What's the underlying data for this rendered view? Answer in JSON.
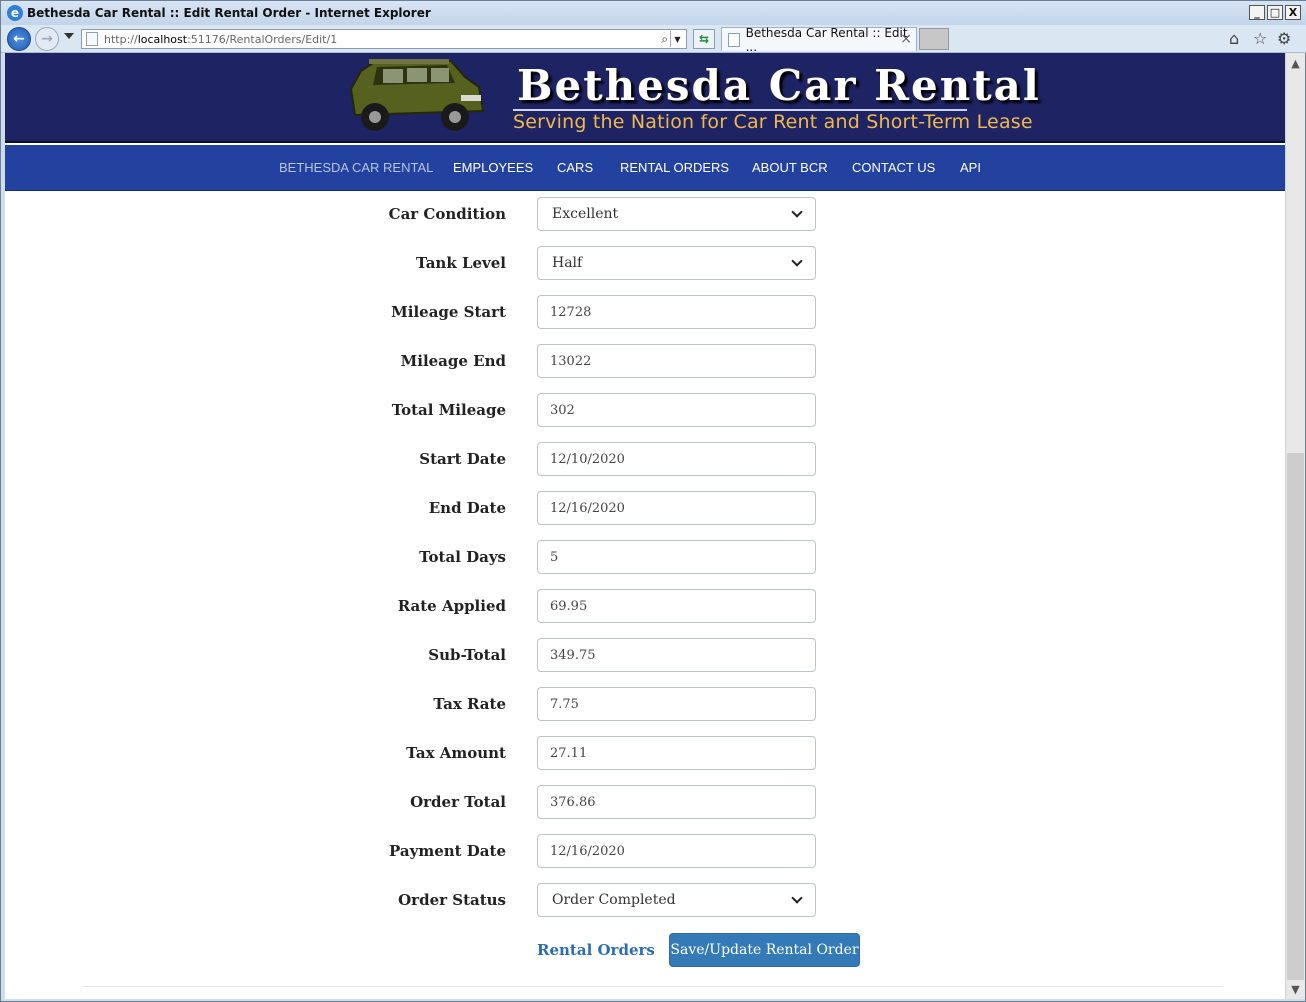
{
  "window": {
    "title": "Bethesda Car Rental :: Edit Rental Order - Internet Explorer",
    "minimize": "_",
    "maximize": "□",
    "close": "X"
  },
  "browser": {
    "url_scheme": "http://",
    "url_host": "localhost",
    "url_rest": ":51176/RentalOrders/Edit/1",
    "tab_title": "Bethesda Car Rental :: Edit ...",
    "tab_close": "×"
  },
  "site": {
    "title": "Bethesda Car Rental",
    "tagline": "Serving the Nation for Car Rent and Short-Term Lease"
  },
  "nav": {
    "brand": "BETHESDA CAR RENTAL",
    "items": [
      "EMPLOYEES",
      "CARS",
      "RENTAL ORDERS",
      "ABOUT BCR",
      "CONTACT US",
      "API"
    ]
  },
  "form": {
    "fields": [
      {
        "label": "Car Condition",
        "value": "Excellent",
        "type": "select"
      },
      {
        "label": "Tank Level",
        "value": "Half",
        "type": "select"
      },
      {
        "label": "Mileage Start",
        "value": "12728",
        "type": "text"
      },
      {
        "label": "Mileage End",
        "value": "13022",
        "type": "text"
      },
      {
        "label": "Total Mileage",
        "value": "302",
        "type": "text"
      },
      {
        "label": "Start Date",
        "value": "12/10/2020",
        "type": "text"
      },
      {
        "label": "End Date",
        "value": "12/16/2020",
        "type": "text"
      },
      {
        "label": "Total Days",
        "value": "5",
        "type": "text"
      },
      {
        "label": "Rate Applied",
        "value": "69.95",
        "type": "text"
      },
      {
        "label": "Sub-Total",
        "value": "349.75",
        "type": "text"
      },
      {
        "label": "Tax Rate",
        "value": "7.75",
        "type": "text"
      },
      {
        "label": "Tax Amount",
        "value": "27.11",
        "type": "text"
      },
      {
        "label": "Order Total",
        "value": "376.86",
        "type": "text"
      },
      {
        "label": "Payment Date",
        "value": "12/16/2020",
        "type": "text"
      },
      {
        "label": "Order Status",
        "value": "Order Completed",
        "type": "select"
      }
    ],
    "back_link": "Rental Orders",
    "save_label": "Save/Update Rental Order"
  },
  "colors": {
    "header_bg": "#1e2363",
    "nav_bg": "#2342a0",
    "tagline": "#f0b94d",
    "button": "#337ab7",
    "link": "#2a6db3"
  }
}
